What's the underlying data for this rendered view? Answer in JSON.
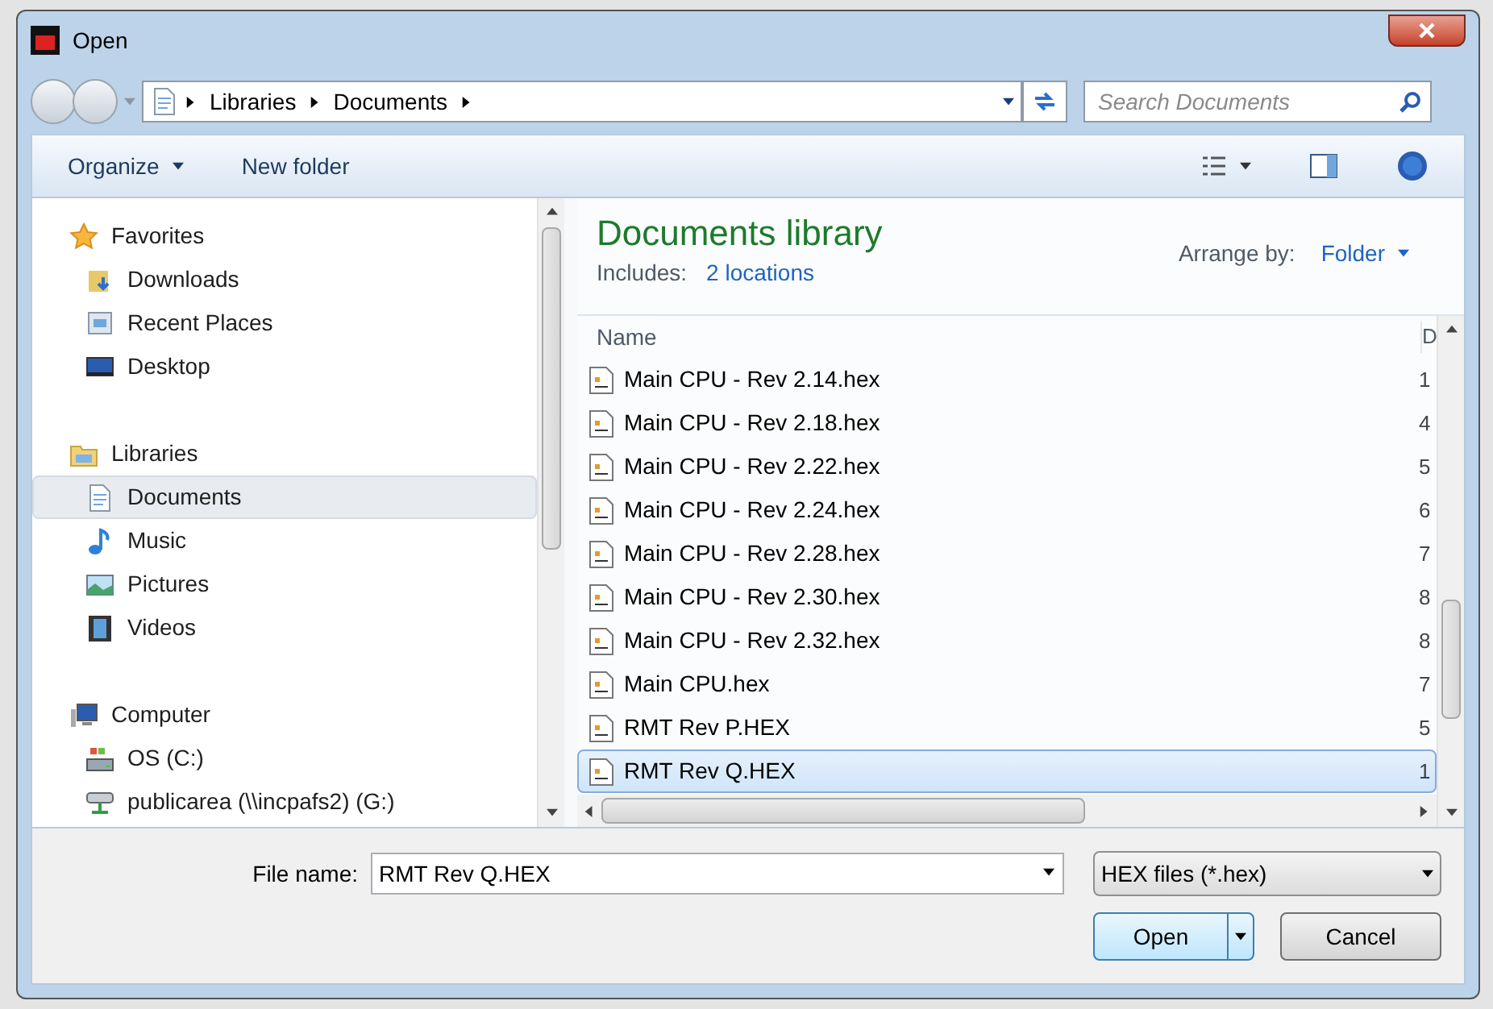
{
  "window": {
    "title": "Open"
  },
  "address": {
    "crumbs": [
      "Libraries",
      "Documents"
    ]
  },
  "search": {
    "placeholder": "Search Documents"
  },
  "toolbar": {
    "buttons": [
      {
        "label": "Organize",
        "kind": "menu"
      },
      {
        "label": "New folder",
        "kind": "plain"
      }
    ]
  },
  "nav": [
    {
      "label": "Favorites",
      "selected": false,
      "children": [
        {
          "label": "Downloads",
          "selected": false
        },
        {
          "label": "Recent Places",
          "selected": false
        },
        {
          "label": "Desktop",
          "selected": false
        }
      ]
    },
    {
      "label": "Libraries",
      "selected": false,
      "children": [
        {
          "label": "Documents",
          "selected": true
        },
        {
          "label": "Music",
          "selected": false
        },
        {
          "label": "Pictures",
          "selected": false
        },
        {
          "label": "Videos",
          "selected": false
        }
      ]
    },
    {
      "label": "Computer",
      "selected": false,
      "children": [
        {
          "label": "OS (C:)",
          "selected": false
        },
        {
          "label": "publicarea (\\\\incpafs2) (G:)",
          "selected": false
        }
      ]
    }
  ],
  "library": {
    "title": "Documents library",
    "includes_label": "Includes:",
    "includes_link": "2 locations",
    "arrange_label": "Arrange by:",
    "arrange_value": "Folder"
  },
  "table": {
    "columns": [
      "Name",
      "D"
    ],
    "rows": [
      {
        "name": "Main CPU - Rev 2.14.hex",
        "column_2": "1",
        "selected": false
      },
      {
        "name": "Main CPU - Rev 2.18.hex",
        "column_2": "4",
        "selected": false
      },
      {
        "name": "Main CPU - Rev 2.22.hex",
        "column_2": "5",
        "selected": false
      },
      {
        "name": "Main CPU - Rev 2.24.hex",
        "column_2": "6",
        "selected": false
      },
      {
        "name": "Main CPU - Rev 2.28.hex",
        "column_2": "7",
        "selected": false
      },
      {
        "name": "Main CPU - Rev 2.30.hex",
        "column_2": "8",
        "selected": false
      },
      {
        "name": "Main CPU - Rev 2.32.hex",
        "column_2": "8",
        "selected": false
      },
      {
        "name": "Main CPU.hex",
        "column_2": "7",
        "selected": false
      },
      {
        "name": "RMT Rev P.HEX",
        "column_2": "5",
        "selected": false
      },
      {
        "name": "RMT Rev Q.HEX",
        "column_2": "1",
        "selected": true
      }
    ]
  },
  "footer": {
    "file_name_label": "File name:",
    "file_name": "RMT Rev Q.HEX",
    "file_type": "HEX files (*.hex)",
    "buttons": [
      {
        "label": "Open",
        "kind": "split"
      },
      {
        "label": "Cancel",
        "kind": "plain"
      }
    ]
  }
}
